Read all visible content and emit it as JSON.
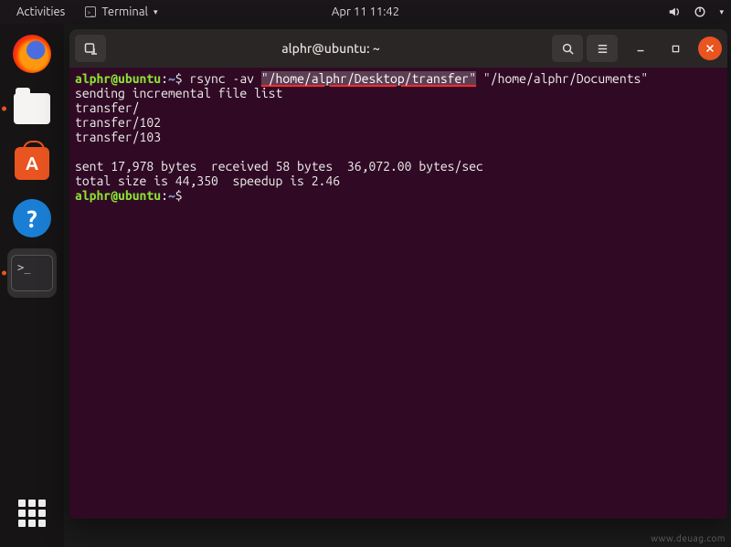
{
  "topbar": {
    "activities": "Activities",
    "app_menu": "Terminal",
    "clock": "Apr 11  11:42"
  },
  "dock": {
    "items": [
      {
        "name": "firefox",
        "label": "Firefox"
      },
      {
        "name": "files",
        "label": "Files"
      },
      {
        "name": "software",
        "label": "Ubuntu Software"
      },
      {
        "name": "help",
        "label": "Help"
      },
      {
        "name": "terminal",
        "label": "Terminal"
      }
    ],
    "show_apps_label": "Show Applications"
  },
  "window": {
    "title": "alphr@ubuntu: ~",
    "tabs_new_label": "New Tab"
  },
  "terminal": {
    "lines": [
      {
        "user": "alphr@ubuntu",
        "path": "~",
        "cmd_prefix": "$ rsync -av ",
        "cmd_hl": "\"/home/alphr/Desktop/transfer\"",
        "cmd_suffix": " \"/home/alphr/Documents\""
      },
      {
        "text": "sending incremental file list"
      },
      {
        "text": "transfer/"
      },
      {
        "text": "transfer/102"
      },
      {
        "text": "transfer/103"
      },
      {
        "text": ""
      },
      {
        "text": "sent 17,978 bytes  received 58 bytes  36,072.00 bytes/sec"
      },
      {
        "text": "total size is 44,350  speedup is 2.46"
      },
      {
        "user": "alphr@ubuntu",
        "path": "~",
        "cmd_prefix": "$ ",
        "cmd_hl": "",
        "cmd_suffix": ""
      }
    ]
  },
  "watermark": "www.deuag.com"
}
